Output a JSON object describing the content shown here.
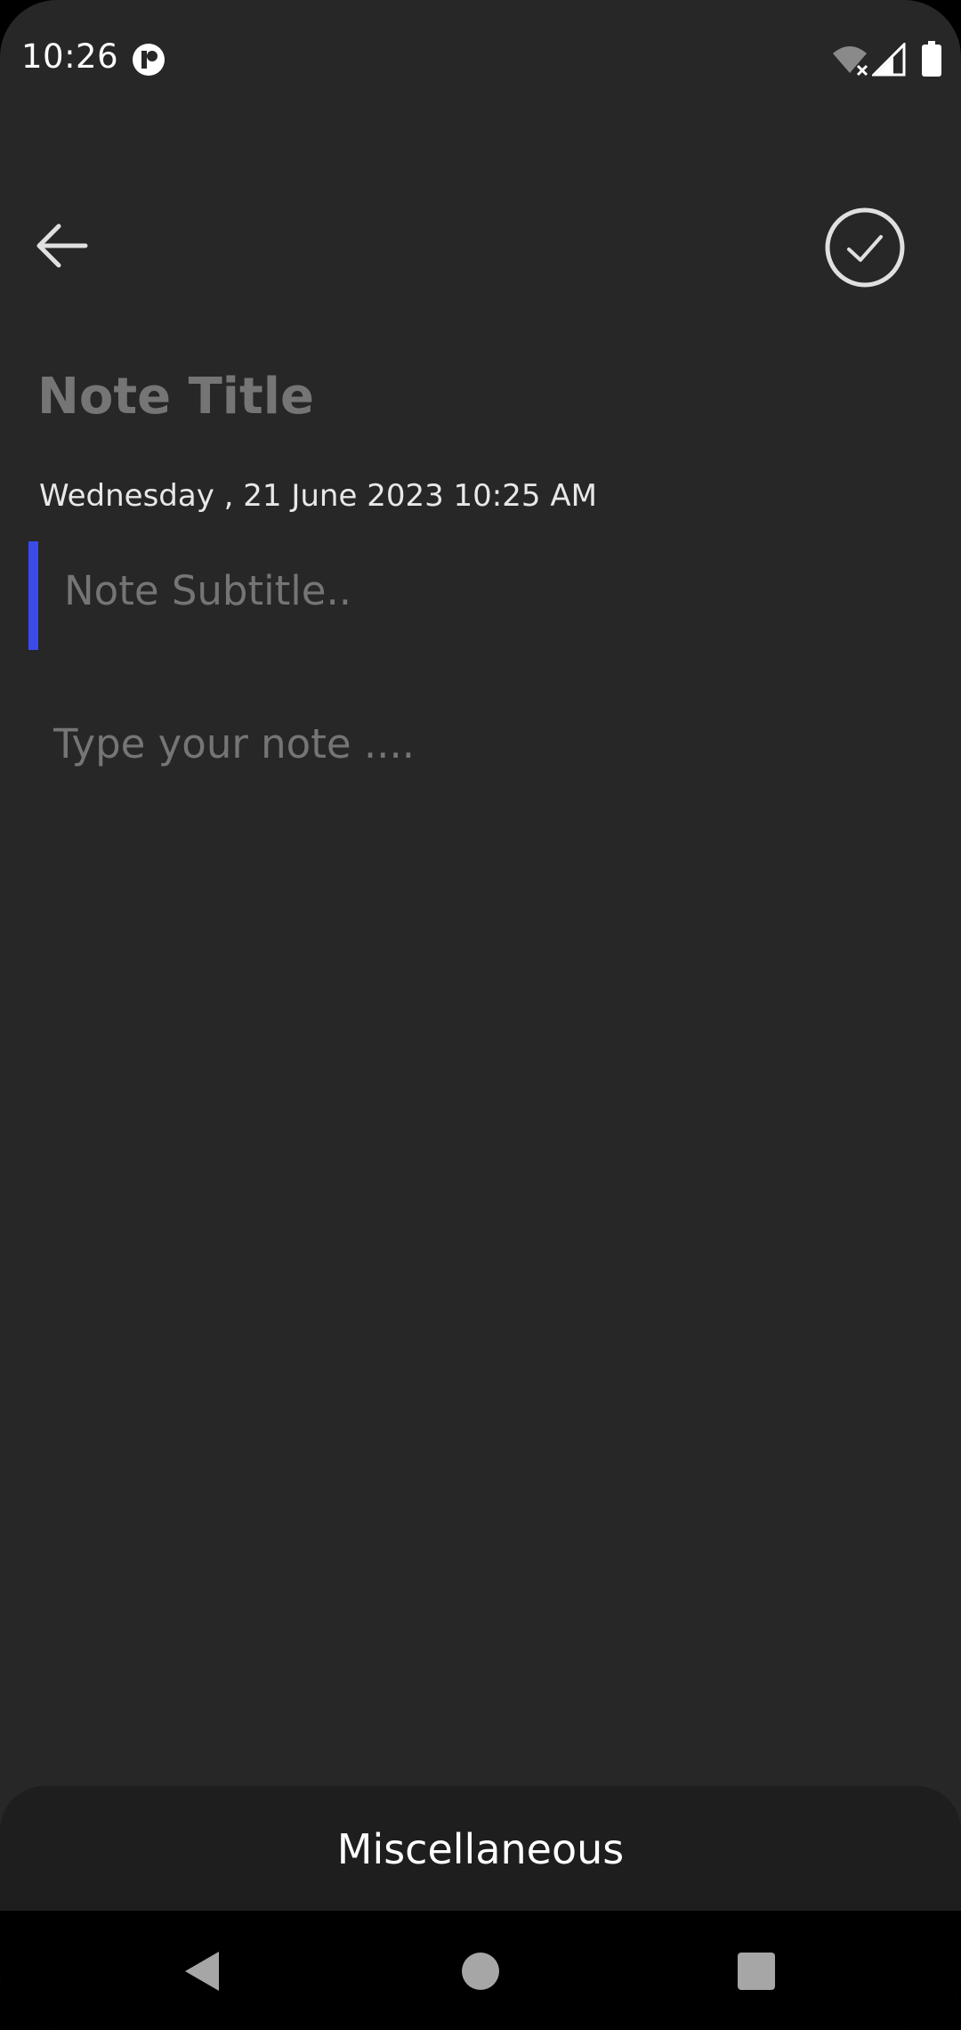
{
  "status_bar": {
    "time": "10:26",
    "icons": [
      "app-notification-icon",
      "wifi-off-icon",
      "cell-signal-icon",
      "battery-icon"
    ]
  },
  "toolbar": {
    "back_icon": "arrow-left-icon",
    "save_icon": "check-circle-icon"
  },
  "note": {
    "title_placeholder": "Note Title",
    "date": "Wednesday , 21 June 2023 10:25 AM",
    "subtitle_placeholder": "Note Subtitle..",
    "body_placeholder": "Type your note ...."
  },
  "category": {
    "label": "Miscellaneous"
  },
  "nav_bar": {
    "icons": [
      "nav-back-icon",
      "nav-home-icon",
      "nav-recents-icon"
    ]
  },
  "colors": {
    "background": "#272727",
    "sheet": "#1e1e1e",
    "accent": "#3b4be8",
    "placeholder": "#6d6d6d",
    "text": "#ffffff"
  }
}
